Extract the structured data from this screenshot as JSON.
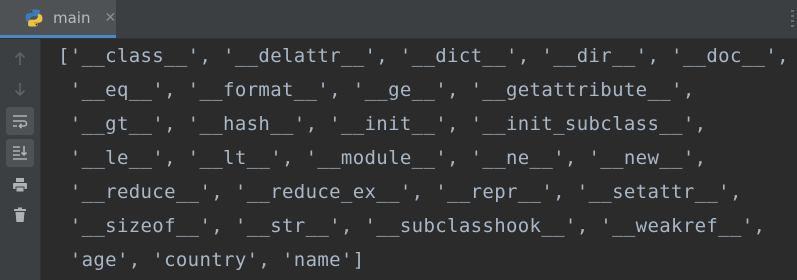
{
  "tab": {
    "label": "main",
    "close_glyph": "✕",
    "icon": "python-icon"
  },
  "toolbar": {
    "buttons": [
      {
        "name": "scroll-up-icon",
        "active": false
      },
      {
        "name": "scroll-down-icon",
        "active": false
      },
      {
        "name": "soft-wrap-icon",
        "active": true
      },
      {
        "name": "scroll-to-end-icon",
        "active": true
      },
      {
        "name": "print-icon",
        "active": false
      },
      {
        "name": "clear-all-icon",
        "active": false
      }
    ]
  },
  "console": {
    "lines": [
      "['__class__', '__delattr__', '__dict__', '__dir__', '__doc__',",
      " '__eq__', '__format__', '__ge__', '__getattribute__',",
      " '__gt__', '__hash__', '__init__', '__init_subclass__',",
      " '__le__', '__lt__', '__module__', '__ne__', '__new__',",
      " '__reduce__', '__reduce_ex__', '__repr__', '__setattr__',",
      " '__sizeof__', '__str__', '__subclasshook__', '__weakref__',",
      " 'age', 'country', 'name']"
    ]
  },
  "colors": {
    "background": "#2b2b2b",
    "panel": "#3c3f41",
    "text": "#a9b7c6",
    "tab_accent": "#4a88c7",
    "python_blue": "#3d7ab8",
    "python_yellow": "#f0c33c"
  }
}
